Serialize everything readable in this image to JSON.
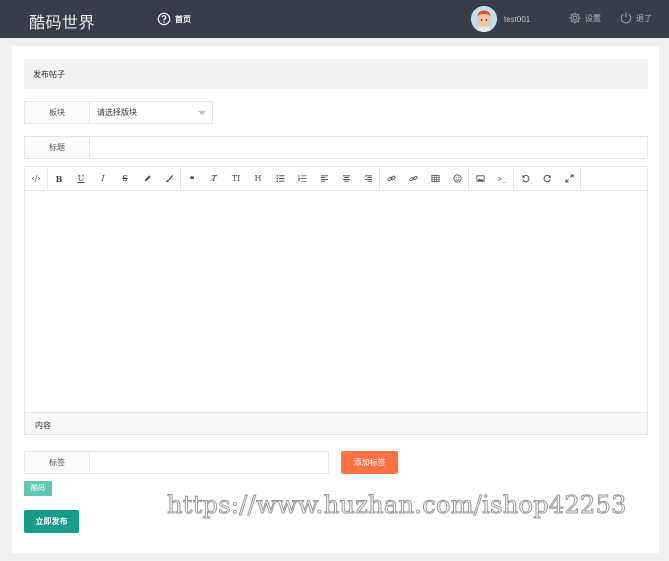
{
  "header": {
    "brand": "酷码世界",
    "nav_home": "首页",
    "username": "test001",
    "settings": "设置",
    "logout": "退了"
  },
  "form": {
    "title": "发布帖子",
    "block_label": "板块",
    "block_value": "请选择版块",
    "subject_label": "标题",
    "subject_value": "",
    "content_label": "内容",
    "tags_label": "标签",
    "tags_value": "",
    "add_tag_button": "添加标签",
    "tag_chip": "酷码",
    "publish_button": "立即发布"
  },
  "editor": {
    "tools": [
      "code-view",
      "bold",
      "underline",
      "italic",
      "strikethrough",
      "pencil",
      "brush",
      "quote",
      "clear-format",
      "text-size",
      "heading",
      "unordered-list",
      "ordered-list",
      "align-left",
      "align-center",
      "align-right",
      "link",
      "unlink",
      "table",
      "emoji",
      "image",
      "code",
      "undo",
      "redo",
      "fullscreen"
    ],
    "glyphs": {
      "code-view": "‹/›",
      "bold": "B",
      "underline": "U",
      "italic": "I",
      "strikethrough": "S",
      "quote": "❝",
      "clear-format": "T̸",
      "text-size": "TI",
      "heading": "H",
      "code": ">_"
    }
  },
  "watermark": "https://www.huzhan.com/ishop42253",
  "colors": {
    "header_bg": "#393d49",
    "orange": "#ff7043",
    "teal": "#179c88",
    "chip": "#64c7b3"
  }
}
